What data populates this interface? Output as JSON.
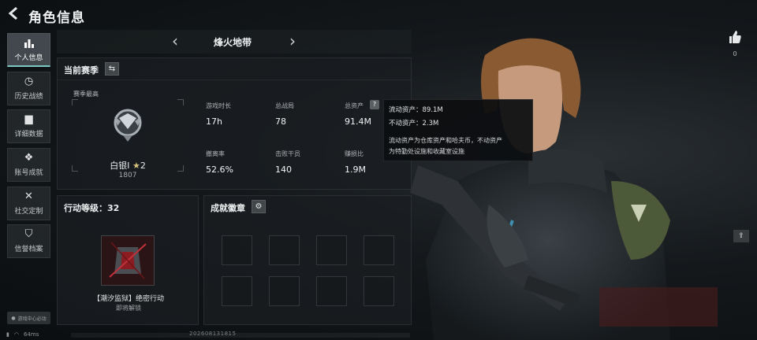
{
  "header": {
    "back_icon": "back-arrow-icon",
    "title": "角色信息"
  },
  "sidebar": {
    "items": [
      {
        "icon": "bar-chart-icon",
        "label": "个人信息",
        "active": true
      },
      {
        "icon": "clock-icon",
        "label": "历史战绩",
        "active": false
      },
      {
        "icon": "folder-icon",
        "label": "详细数据",
        "active": false
      },
      {
        "icon": "badge-icon",
        "label": "账号成就",
        "active": false
      },
      {
        "icon": "tools-icon",
        "label": "社交定制",
        "active": false
      },
      {
        "icon": "shield-icon",
        "label": "信誉档案",
        "active": false
      }
    ],
    "voice_label": "游戏中心必动"
  },
  "mode_selector": {
    "name": "烽火地带"
  },
  "season_panel": {
    "title": "当前赛季",
    "season_best": "赛季最高",
    "rank_name": "白银I",
    "rank_stars": "2",
    "rank_points": "1807",
    "stats": [
      {
        "label": "游戏时长",
        "value": "17h"
      },
      {
        "label": "总战局",
        "value": "78"
      },
      {
        "label": "总资产",
        "value": "91.4M"
      },
      {
        "label": "撤离率",
        "value": "52.6%"
      },
      {
        "label": "击败干员",
        "value": "140"
      },
      {
        "label": "赚损比",
        "value": "1.9M"
      }
    ]
  },
  "tooltip": {
    "liquid": "流动资产：89.1M",
    "fixed": "不动资产：2.3M",
    "desc_line1": "流动资产为仓库资产和哈夫币，不动资产",
    "desc_line2": "为特勤处设施和收藏室设施"
  },
  "level_panel": {
    "title": "行动等级：32",
    "mission_name": "【潮汐监狱】绝密行动",
    "mission_status": "即将解锁"
  },
  "achievement_panel": {
    "title": "成就徽章",
    "settings_icon": "gear-icon"
  },
  "right": {
    "like_count": "0",
    "like_icon": "thumbs-up-icon",
    "share_icon": "share-icon"
  },
  "status": {
    "ping": "64ms",
    "build": "20260813181​5"
  },
  "colors": {
    "accent": "#7ec8c4",
    "panel": "#1a1e21",
    "text": "#d8dadb"
  }
}
